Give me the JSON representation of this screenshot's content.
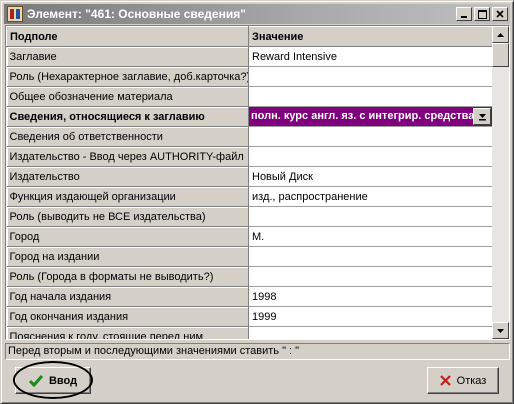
{
  "window": {
    "title": "Элемент: \"461: Основные сведения\"",
    "app_icon": "library-icon"
  },
  "titlebar_buttons": {
    "minimize": "_",
    "maximize": "□",
    "close": "✕"
  },
  "grid": {
    "headers": {
      "field": "Подполе",
      "value": "Значение"
    },
    "rows": [
      {
        "name": "Заглавие",
        "value": "Reward Intensive"
      },
      {
        "name": "Роль (Нехарактерное заглавие, доб.карточка?)",
        "value": ""
      },
      {
        "name": "Общее обозначение материала",
        "value": ""
      },
      {
        "name": "Сведения, относящиеся к заглавию",
        "value": "полн. курс англ. яз. с интегрир. средства"
      },
      {
        "name": "Сведения об ответственности",
        "value": ""
      },
      {
        "name": "Издательство - Ввод через AUTHORITY-файл",
        "value": ""
      },
      {
        "name": "Издательство",
        "value": "Новый Диск"
      },
      {
        "name": "Функция издающей организации",
        "value": "изд., распространение"
      },
      {
        "name": "Роль (выводить не ВСЕ издательства)",
        "value": ""
      },
      {
        "name": "Город",
        "value": "М."
      },
      {
        "name": "Город на издании",
        "value": ""
      },
      {
        "name": "Роль (Города в форматы не выводить?)",
        "value": ""
      },
      {
        "name": "Год начала издания",
        "value": "1998"
      },
      {
        "name": "Год окончания издания",
        "value": "1999"
      },
      {
        "name": "Пояснения к году, стоящие перед ним",
        "value": ""
      }
    ],
    "selected_index": 3,
    "selected_color": "#800080"
  },
  "hint": "Перед вторым и последующими значениями ставить \" : \"",
  "buttons": {
    "ok": "Ввод",
    "cancel": "Отказ"
  },
  "icons": {
    "ok": "checkmark-icon",
    "cancel": "cross-icon",
    "dropdown": "dropdown-arrow-icon"
  }
}
